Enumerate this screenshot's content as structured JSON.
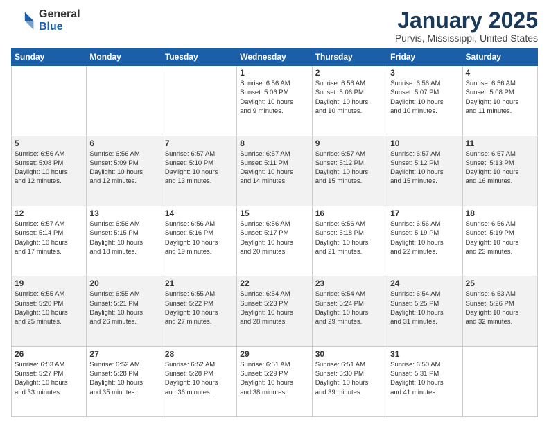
{
  "header": {
    "logo_general": "General",
    "logo_blue": "Blue",
    "month_title": "January 2025",
    "location": "Purvis, Mississippi, United States"
  },
  "calendar": {
    "days_of_week": [
      "Sunday",
      "Monday",
      "Tuesday",
      "Wednesday",
      "Thursday",
      "Friday",
      "Saturday"
    ],
    "weeks": [
      [
        {
          "day": "",
          "info": ""
        },
        {
          "day": "",
          "info": ""
        },
        {
          "day": "",
          "info": ""
        },
        {
          "day": "1",
          "info": "Sunrise: 6:56 AM\nSunset: 5:06 PM\nDaylight: 10 hours\nand 9 minutes."
        },
        {
          "day": "2",
          "info": "Sunrise: 6:56 AM\nSunset: 5:06 PM\nDaylight: 10 hours\nand 10 minutes."
        },
        {
          "day": "3",
          "info": "Sunrise: 6:56 AM\nSunset: 5:07 PM\nDaylight: 10 hours\nand 10 minutes."
        },
        {
          "day": "4",
          "info": "Sunrise: 6:56 AM\nSunset: 5:08 PM\nDaylight: 10 hours\nand 11 minutes."
        }
      ],
      [
        {
          "day": "5",
          "info": "Sunrise: 6:56 AM\nSunset: 5:08 PM\nDaylight: 10 hours\nand 12 minutes."
        },
        {
          "day": "6",
          "info": "Sunrise: 6:56 AM\nSunset: 5:09 PM\nDaylight: 10 hours\nand 12 minutes."
        },
        {
          "day": "7",
          "info": "Sunrise: 6:57 AM\nSunset: 5:10 PM\nDaylight: 10 hours\nand 13 minutes."
        },
        {
          "day": "8",
          "info": "Sunrise: 6:57 AM\nSunset: 5:11 PM\nDaylight: 10 hours\nand 14 minutes."
        },
        {
          "day": "9",
          "info": "Sunrise: 6:57 AM\nSunset: 5:12 PM\nDaylight: 10 hours\nand 15 minutes."
        },
        {
          "day": "10",
          "info": "Sunrise: 6:57 AM\nSunset: 5:12 PM\nDaylight: 10 hours\nand 15 minutes."
        },
        {
          "day": "11",
          "info": "Sunrise: 6:57 AM\nSunset: 5:13 PM\nDaylight: 10 hours\nand 16 minutes."
        }
      ],
      [
        {
          "day": "12",
          "info": "Sunrise: 6:57 AM\nSunset: 5:14 PM\nDaylight: 10 hours\nand 17 minutes."
        },
        {
          "day": "13",
          "info": "Sunrise: 6:56 AM\nSunset: 5:15 PM\nDaylight: 10 hours\nand 18 minutes."
        },
        {
          "day": "14",
          "info": "Sunrise: 6:56 AM\nSunset: 5:16 PM\nDaylight: 10 hours\nand 19 minutes."
        },
        {
          "day": "15",
          "info": "Sunrise: 6:56 AM\nSunset: 5:17 PM\nDaylight: 10 hours\nand 20 minutes."
        },
        {
          "day": "16",
          "info": "Sunrise: 6:56 AM\nSunset: 5:18 PM\nDaylight: 10 hours\nand 21 minutes."
        },
        {
          "day": "17",
          "info": "Sunrise: 6:56 AM\nSunset: 5:19 PM\nDaylight: 10 hours\nand 22 minutes."
        },
        {
          "day": "18",
          "info": "Sunrise: 6:56 AM\nSunset: 5:19 PM\nDaylight: 10 hours\nand 23 minutes."
        }
      ],
      [
        {
          "day": "19",
          "info": "Sunrise: 6:55 AM\nSunset: 5:20 PM\nDaylight: 10 hours\nand 25 minutes."
        },
        {
          "day": "20",
          "info": "Sunrise: 6:55 AM\nSunset: 5:21 PM\nDaylight: 10 hours\nand 26 minutes."
        },
        {
          "day": "21",
          "info": "Sunrise: 6:55 AM\nSunset: 5:22 PM\nDaylight: 10 hours\nand 27 minutes."
        },
        {
          "day": "22",
          "info": "Sunrise: 6:54 AM\nSunset: 5:23 PM\nDaylight: 10 hours\nand 28 minutes."
        },
        {
          "day": "23",
          "info": "Sunrise: 6:54 AM\nSunset: 5:24 PM\nDaylight: 10 hours\nand 29 minutes."
        },
        {
          "day": "24",
          "info": "Sunrise: 6:54 AM\nSunset: 5:25 PM\nDaylight: 10 hours\nand 31 minutes."
        },
        {
          "day": "25",
          "info": "Sunrise: 6:53 AM\nSunset: 5:26 PM\nDaylight: 10 hours\nand 32 minutes."
        }
      ],
      [
        {
          "day": "26",
          "info": "Sunrise: 6:53 AM\nSunset: 5:27 PM\nDaylight: 10 hours\nand 33 minutes."
        },
        {
          "day": "27",
          "info": "Sunrise: 6:52 AM\nSunset: 5:28 PM\nDaylight: 10 hours\nand 35 minutes."
        },
        {
          "day": "28",
          "info": "Sunrise: 6:52 AM\nSunset: 5:28 PM\nDaylight: 10 hours\nand 36 minutes."
        },
        {
          "day": "29",
          "info": "Sunrise: 6:51 AM\nSunset: 5:29 PM\nDaylight: 10 hours\nand 38 minutes."
        },
        {
          "day": "30",
          "info": "Sunrise: 6:51 AM\nSunset: 5:30 PM\nDaylight: 10 hours\nand 39 minutes."
        },
        {
          "day": "31",
          "info": "Sunrise: 6:50 AM\nSunset: 5:31 PM\nDaylight: 10 hours\nand 41 minutes."
        },
        {
          "day": "",
          "info": ""
        }
      ]
    ]
  }
}
